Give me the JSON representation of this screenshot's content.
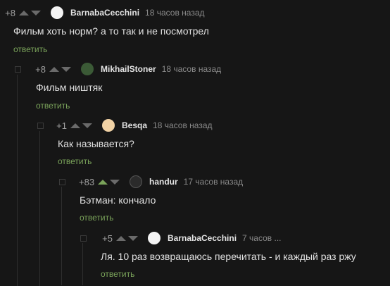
{
  "comments": [
    {
      "rating": "+8",
      "author": "BarnabaCecchini",
      "time": "18 часов назад",
      "text": "Фильм хоть норм? а то так и не посмотрел",
      "reply": "ответить"
    },
    {
      "rating": "+8",
      "author": "MikhailStoner",
      "time": "18 часов назад",
      "text": "Фильм ништяк",
      "reply": "ответить"
    },
    {
      "rating": "+1",
      "author": "Besqa",
      "time": "18 часов назад",
      "text": "Как называется?",
      "reply": "ответить"
    },
    {
      "rating": "+83",
      "author": "handur",
      "time": "17 часов назад",
      "text": "Бэтман: кончало",
      "reply": "ответить"
    },
    {
      "rating": "+5",
      "author": "BarnabaCecchini",
      "time": "7 часов ...",
      "text": "Ля. 10 раз возвращаюсь перечитать  - и каждый раз ржу",
      "reply": "ответить"
    }
  ],
  "colors": {
    "accent": "#7aa35a",
    "background": "#161616"
  }
}
